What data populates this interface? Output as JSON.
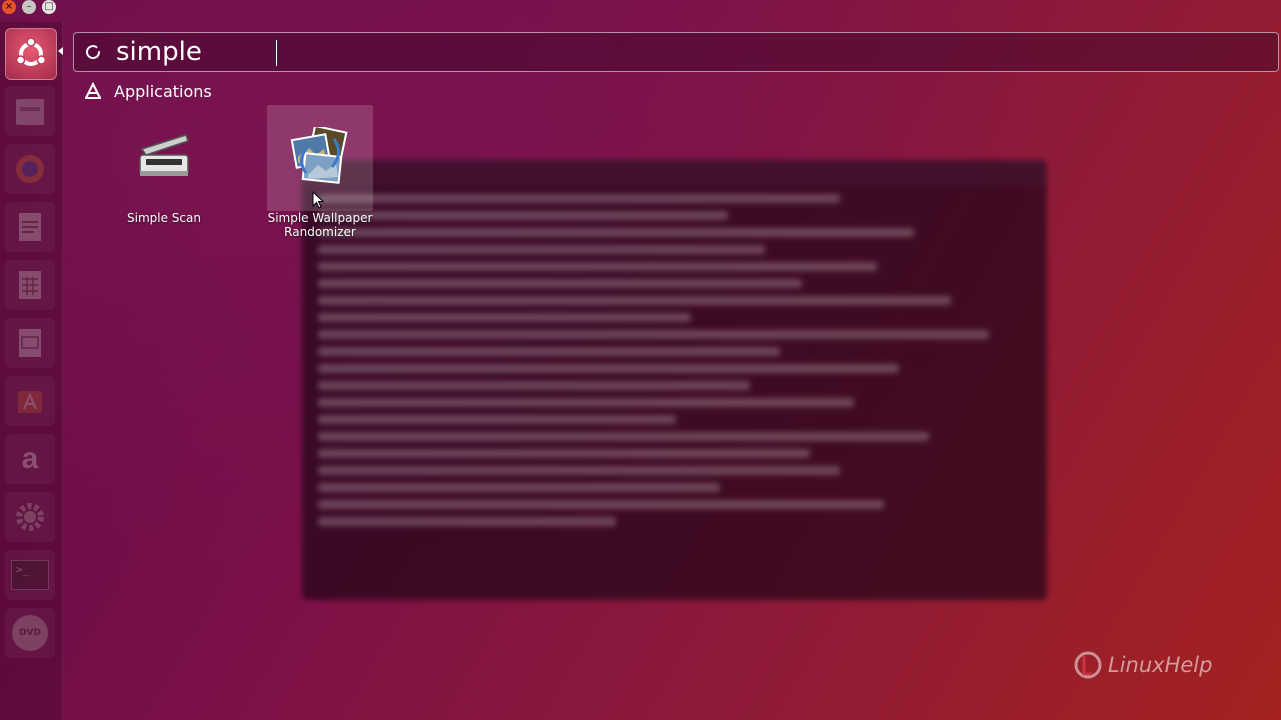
{
  "window_controls": {
    "close": "×",
    "minimize": "–",
    "maximize": "□"
  },
  "launcher": {
    "items": [
      {
        "name": "ubuntu-dash",
        "icon": "ubuntu-logo-icon",
        "active": true
      },
      {
        "name": "files",
        "icon": "file-cabinet-icon"
      },
      {
        "name": "firefox",
        "icon": "firefox-icon"
      },
      {
        "name": "writer",
        "icon": "document-icon"
      },
      {
        "name": "calc",
        "icon": "spreadsheet-icon"
      },
      {
        "name": "impress",
        "icon": "presentation-icon"
      },
      {
        "name": "software-center",
        "icon": "software-center-icon"
      },
      {
        "name": "amazon",
        "icon": "amazon-icon",
        "glyph": "a"
      },
      {
        "name": "settings",
        "icon": "gear-icon"
      },
      {
        "name": "terminal",
        "icon": "terminal-icon",
        "glyph": ">_"
      },
      {
        "name": "dvd",
        "icon": "dvd-icon",
        "glyph": "DVD"
      }
    ]
  },
  "search": {
    "value": "simple"
  },
  "category": {
    "title": "Applications",
    "icon": "applications-icon"
  },
  "results": [
    {
      "label": "Simple Scan",
      "icon": "scanner-icon",
      "selected": false
    },
    {
      "label": "Simple Wallpaper Randomizer",
      "icon": "wallpaper-photos-icon",
      "selected": true
    }
  ],
  "watermark": {
    "text": "LinuxHelp"
  },
  "colors": {
    "background_start": "#5c0a45",
    "background_end": "#a3221f",
    "accent": "#e85a70"
  }
}
